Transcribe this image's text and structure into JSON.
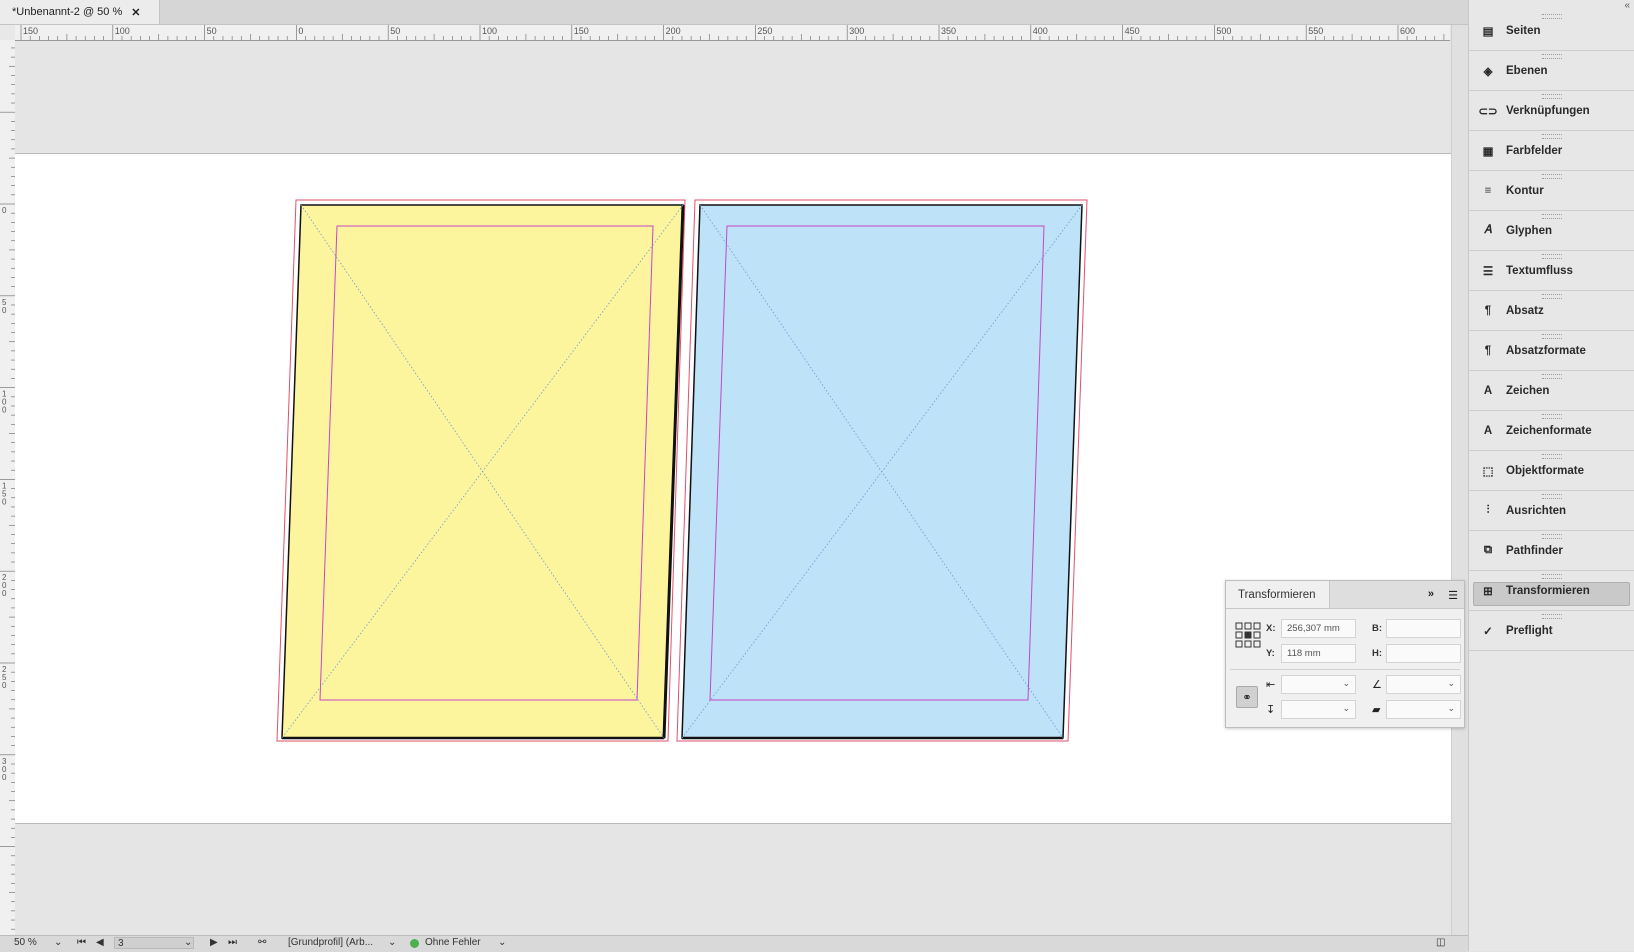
{
  "document": {
    "tab_title": "*Unbenannt-2 @ 50 %",
    "close_glyph": "✕"
  },
  "ruler": {
    "horizontal_ticks": [
      "150",
      "100",
      "50",
      "0",
      "50",
      "100",
      "150",
      "200",
      "250",
      "300",
      "350",
      "400",
      "450",
      "500",
      "550",
      "600"
    ],
    "vertical_ticks": [
      "0",
      "5\n0",
      "1\n0\n0",
      "1\n5\n0",
      "2\n0\n0",
      "2\n5\n0",
      "3\n0\n0"
    ]
  },
  "panels": {
    "items": [
      {
        "label": "Seiten",
        "icon": "pages-icon"
      },
      {
        "label": "Ebenen",
        "icon": "layers-icon"
      },
      {
        "label": "Verknüpfungen",
        "icon": "links-icon"
      },
      {
        "label": "Farbfelder",
        "icon": "swatches-icon"
      },
      {
        "label": "Kontur",
        "icon": "stroke-icon"
      },
      {
        "label": "Glyphen",
        "icon": "glyphs-icon"
      },
      {
        "label": "Textumfluss",
        "icon": "text-wrap-icon"
      },
      {
        "label": "Absatz",
        "icon": "paragraph-icon"
      },
      {
        "label": "Absatzformate",
        "icon": "paragraph-styles-icon"
      },
      {
        "label": "Zeichen",
        "icon": "character-icon"
      },
      {
        "label": "Zeichenformate",
        "icon": "character-styles-icon"
      },
      {
        "label": "Objektformate",
        "icon": "object-styles-icon"
      },
      {
        "label": "Ausrichten",
        "icon": "align-icon"
      },
      {
        "label": "Pathfinder",
        "icon": "pathfinder-icon"
      },
      {
        "label": "Transformieren",
        "icon": "transform-icon",
        "active": true
      },
      {
        "label": "Preflight",
        "icon": "preflight-icon"
      }
    ]
  },
  "transform_panel": {
    "title": "Transformieren",
    "expand_glyph": "»",
    "x_label": "X:",
    "x_value": "256,307 mm",
    "y_label": "Y:",
    "y_value": "118 mm",
    "w_label": "B:",
    "w_value": "",
    "h_label": "H:",
    "h_value": ""
  },
  "status": {
    "zoom": "50 %",
    "page": "3",
    "profile": "[Grundprofil] (Arb...",
    "preflight": "Ohne Fehler"
  },
  "colors": {
    "yellow_page": "#fdf59d",
    "blue_page": "#bee2f7",
    "margin_guide": "#c547c9",
    "bleed_guide": "#e0506e"
  }
}
